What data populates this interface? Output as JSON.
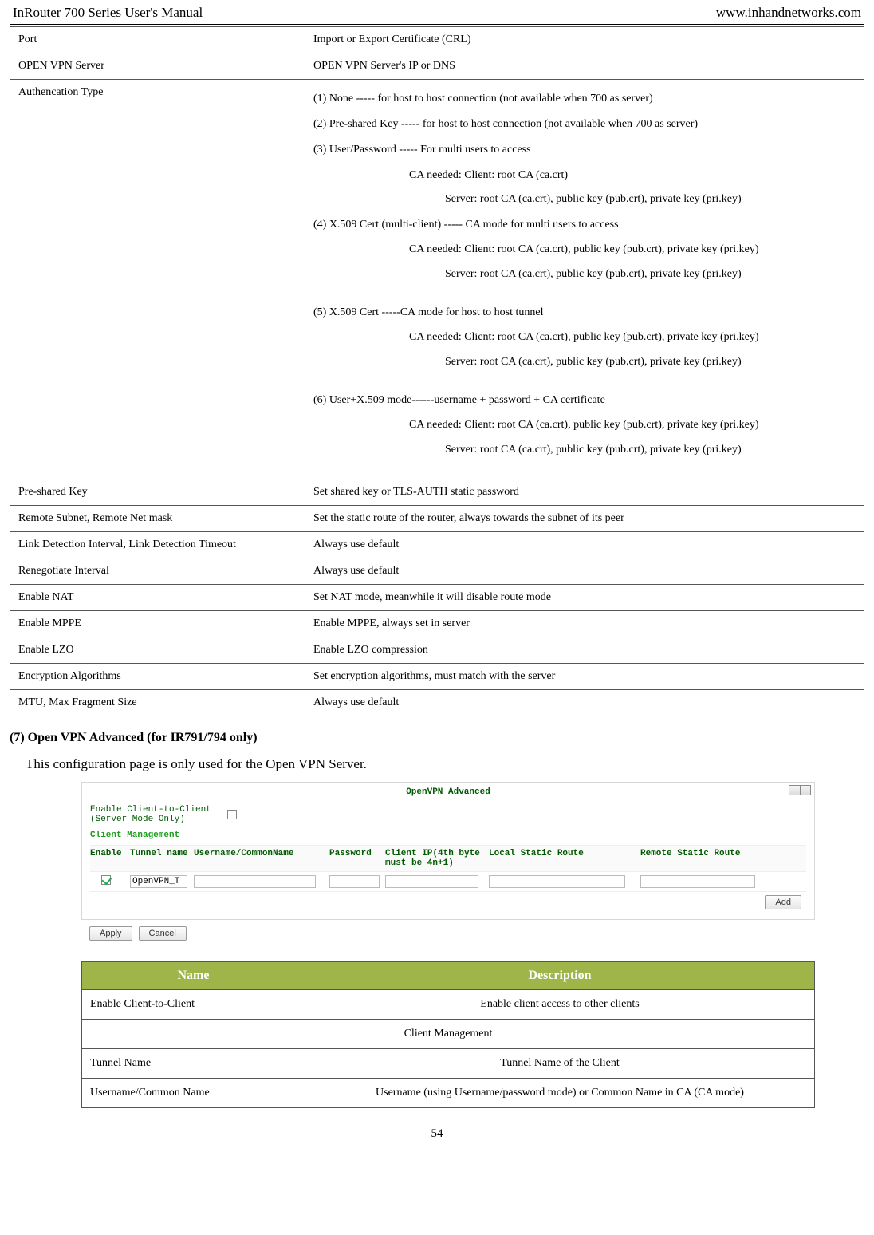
{
  "header": {
    "left": "InRouter 700 Series User's Manual",
    "right": "www.inhandnetworks.com"
  },
  "table1": {
    "rows": [
      {
        "k": "Port",
        "v": "Import or Export Certificate    (CRL)"
      },
      {
        "k": "OPEN VPN Server",
        "v": "OPEN VPN Server's IP or DNS"
      }
    ],
    "auth": {
      "k": "Authencation Type",
      "lines": [
        "(1) None ----- for host to host connection (not available when 700 as server)",
        "(2) Pre-shared Key ----- for host to host connection (not available when 700 as server)",
        "(3) User/Password ----- For multi users to access"
      ],
      "indents": [
        {
          "lvl": 1,
          "t": "CA needed: Client: root CA (ca.crt)"
        },
        {
          "lvl": 2,
          "t": "Server: root CA (ca.crt), public key (pub.crt), private key (pri.key)"
        }
      ],
      "line4": "(4) X.509 Cert (multi-client) ----- CA mode for multi users to access",
      "indents4": [
        {
          "lvl": 1,
          "t": "CA needed: Client: root CA (ca.crt), public key (pub.crt), private key (pri.key)"
        },
        {
          "lvl": 2,
          "t": "Server: root CA (ca.crt), public key (pub.crt), private key (pri.key)"
        }
      ],
      "line5": "(5) X.509 Cert -----CA mode for host to host tunnel",
      "indents5": [
        {
          "lvl": 1,
          "t": "CA needed: Client: root CA (ca.crt), public key (pub.crt), private key (pri.key)"
        },
        {
          "lvl": 2,
          "t": "Server: root CA (ca.crt), public key (pub.crt), private key (pri.key)"
        }
      ],
      "line6": "(6) User+X.509 mode------username + password + CA certificate",
      "indents6": [
        {
          "lvl": 1,
          "t": "CA needed: Client: root CA (ca.crt), public key (pub.crt), private key (pri.key)"
        },
        {
          "lvl": 2,
          "t": "Server: root CA (ca.crt), public key (pub.crt), private key (pri.key)"
        }
      ]
    },
    "rest": [
      {
        "k": "Pre-shared Key",
        "v": "Set shared key or TLS-AUTH static password"
      },
      {
        "k": "Remote Subnet, Remote Net mask",
        "v": "Set the static route of the router, always towards the subnet of its peer"
      },
      {
        "k": "Link Detection Interval, Link Detection Timeout",
        "v": "Always use default"
      },
      {
        "k": "Renegotiate Interval",
        "v": "Always use default"
      },
      {
        "k": "Enable NAT",
        "v": "Set NAT mode, meanwhile it will disable route mode"
      },
      {
        "k": "Enable MPPE",
        "v": "Enable MPPE, always set in server"
      },
      {
        "k": "Enable LZO",
        "v": "Enable LZO compression"
      },
      {
        "k": "Encryption Algorithms",
        "v": "Set encryption algorithms, must match with the server"
      },
      {
        "k": "MTU, Max Fragment Size",
        "v": "Always use default"
      }
    ]
  },
  "section": {
    "title": "(7)   Open VPN Advanced (for IR791/794 only)",
    "intro": "This configuration page is only used for the Open VPN Server."
  },
  "panel": {
    "title": "OpenVPN Advanced",
    "enable_label": "Enable Client-to-Client\n(Server Mode Only)",
    "client_mgmt": "Client Management",
    "cols": {
      "c1": "Enable",
      "c2": "Tunnel name",
      "c3": "Username/CommonName",
      "c4": "Password",
      "c5": "Client IP(4th byte must be 4n+1)",
      "c6": "Local Static Route",
      "c7": "Remote Static Route"
    },
    "row": {
      "tunnel": "OpenVPN_T"
    },
    "add_btn": "Add",
    "apply": "Apply",
    "cancel": "Cancel"
  },
  "desc": {
    "head": {
      "name": "Name",
      "desc": "Description"
    },
    "rows": [
      {
        "k": "Enable Client-to-Client",
        "v": "Enable client access to other clients"
      }
    ],
    "span": "Client Management",
    "rows2": [
      {
        "k": "Tunnel Name",
        "v": "Tunnel Name of the Client"
      },
      {
        "k": "Username/Common Name",
        "v": "Username (using Username/password mode) or Common Name in CA (CA mode)"
      }
    ]
  },
  "page": "54"
}
